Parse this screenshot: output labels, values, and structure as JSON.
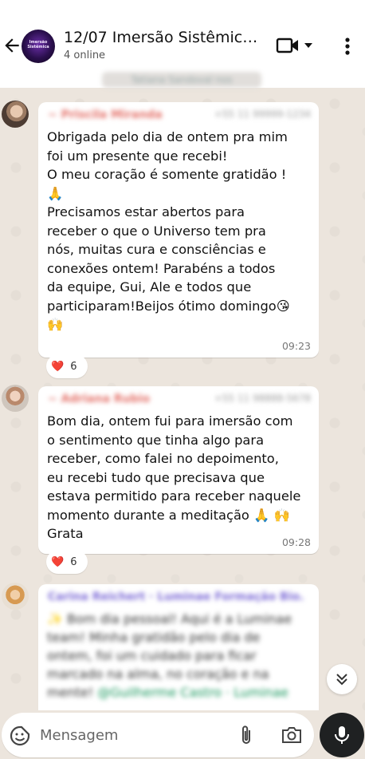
{
  "header": {
    "title": "12/07 Imersão Sistêmica...",
    "subtitle": "4 online",
    "avatar_text": "Imersão Sistêmica"
  },
  "chat": {
    "day_chip": "Tatiana Sandoval nos",
    "messages": [
      {
        "sender": "~ Priscila Miranda",
        "sender_meta": "+55 11 99999-1234",
        "text": "Obrigada pelo dia de ontem pra mim\nfoi um presente que recebi!\nO meu coração é somente gratidão !\n🙏\nPrecisamos estar abertos para\nreceber o que o Universo tem pra\nnós, muitas cura e consciências e\nconexões ontem! Parabéns a todos\nda equipe, Gui, Ale e todos que\nparticiparam!Beijos ótimo domingo😘\n🙌",
        "time": "09:23",
        "reaction_emoji": "❤️",
        "reaction_count": "6"
      },
      {
        "sender": "~ Adriana Rubio",
        "sender_meta": "+55 11 98888-5678",
        "text": "Bom dia, ontem fui para imersão com\no sentimento que tinha algo para\nreceber, como falei no depoimento,\neu recebi tudo que precisava que\nestava permitido para receber naquele\nmomento durante a meditação 🙏 🙌\nGrata",
        "time": "09:28",
        "reaction_emoji": "❤️",
        "reaction_count": "6"
      },
      {
        "sender": "Carina Reichert · Luminae Formação Bio...",
        "text": "✨ Bom dia pessoal! Aqui é a Luminae\nteam! Minha gratidão pelo dia de\nontem, foi um cuidado para ficar\nmarcado na alma, no coração e na\nmente!",
        "mention": "@Guilherme Castro · Luminae"
      }
    ]
  },
  "composer": {
    "placeholder": "Mensagem"
  },
  "colors": {
    "background": "#ece5dd",
    "bubble": "#ffffff",
    "sender1": "#e4726a",
    "sender3": "#7c6ad6",
    "mic_button": "#1f2122"
  }
}
